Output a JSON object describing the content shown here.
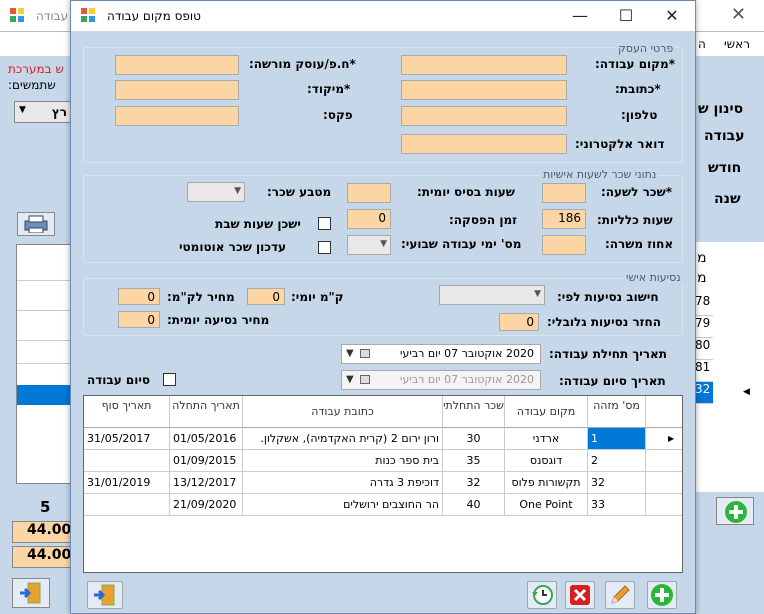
{
  "background": {
    "title": "ת עבודה",
    "menu_item": "ראשי",
    "menu_item2": "ה",
    "red_line1": "ש במערכת",
    "line2": "שתמשים:",
    "combo_text": "רץ",
    "filter_label": "סינון ש",
    "filter_opts": [
      "עבודה",
      "חודש",
      "שנה"
    ],
    "list_header": [
      "מ",
      "מ"
    ],
    "list_rows": [
      "78",
      "79",
      "80",
      "81",
      "32"
    ],
    "count": "5",
    "val1": "44.00",
    "val2": "44.00"
  },
  "dialog": {
    "title": "טופס מקום עבודה",
    "minimize": "—",
    "maximize": "☐",
    "close": "✕"
  },
  "business": {
    "legend": "פרטי העסק",
    "workplace": "*מקום עבודה:",
    "address": "*כתובת:",
    "phone": "טלפון:",
    "email": "דואר אלקטרוני:",
    "company_id": "*ח.פ/עוסק מורשה:",
    "zip": "*מיקוד:",
    "fax": "פקס:"
  },
  "salary": {
    "legend": "נתוני שכר לשעות אישיות",
    "hourly": "*שכר לשעה:",
    "total_hours": "שעות כלליות:",
    "total_hours_val": "186",
    "last_pos": "אחוז משרה:",
    "base_hours": "שעות בסיס יומית:",
    "break": "זמן הפסקה:",
    "break_val": "0",
    "workdays": "מס' ימי עבודה שבועי:",
    "currency": "מטבע שכר:",
    "saturday": "ישכן שעות שבת",
    "auto_update": "עדכון שכר אוטומטי"
  },
  "travel": {
    "legend": "נסיעות אישי",
    "calc": "חישוב נסיעות לפי:",
    "refund": "החזר נסיעות גלובלי:",
    "refund_val": "0",
    "km_daily": "ק\"מ יומי:",
    "km_daily_val": "0",
    "km_price": "מחיר לק\"מ:",
    "km_price_val": "0",
    "daily_price": "מחיר נסיעה יומית:",
    "daily_price_val": "0"
  },
  "dates": {
    "start_label": "תאריך תחילת עבודה:",
    "start_val": "2020 אוקטובר 07  יום רביעי",
    "end_label": "תאריך סיום עבודה:",
    "end_val": "2020 אוקטובר 07  יום רביעי",
    "finished": "סיום עבודה"
  },
  "table": {
    "headers": [
      "מס' מזהה",
      "מקום עבודה",
      "שכר התחלתי",
      "כתובת עבודה",
      "תאריך התחלה",
      "תאריך סוף"
    ],
    "rows": [
      {
        "id": "1",
        "place": "ארדני",
        "pay": "30",
        "address": "ורון ירום 2 (קרית האקדמיה), אשקלון.",
        "start": "01/05/2016",
        "end": "31/05/2017"
      },
      {
        "id": "2",
        "place": "דוגסנס",
        "pay": "35",
        "address": "בית ספר כנות",
        "start": "01/09/2015",
        "end": ""
      },
      {
        "id": "32",
        "place": "תקשורות פלוס",
        "pay": "32",
        "address": "דוכיפת 3 גדרה",
        "start": "13/12/2017",
        "end": "31/01/2019"
      },
      {
        "id": "33",
        "place": "One Point",
        "pay": "40",
        "address": "הר החוצבים ירושלים",
        "start": "21/09/2020",
        "end": ""
      }
    ]
  },
  "colors": {
    "field": "#fbd5a4",
    "panel": "#c6d7ea",
    "selected": "#0078d7",
    "red": "#d42020",
    "green": "#2bb53a"
  }
}
